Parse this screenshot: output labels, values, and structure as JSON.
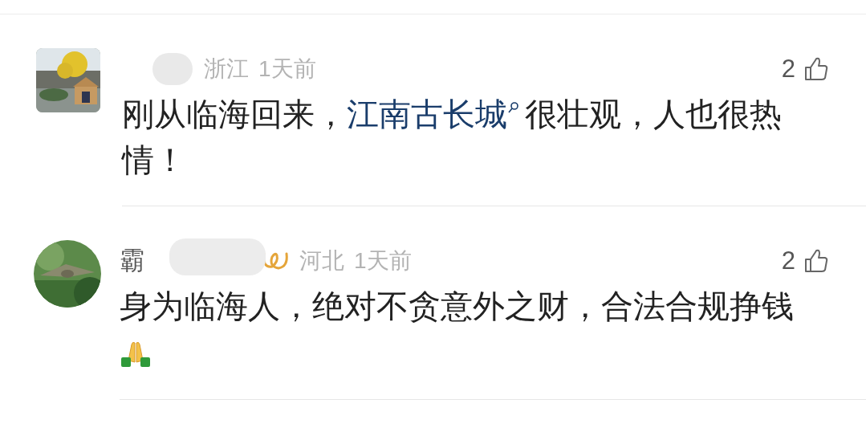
{
  "comments": [
    {
      "avatar": {
        "kind": "square"
      },
      "vip": false,
      "region": "浙江",
      "time": "1天前",
      "likes": "2",
      "body": [
        {
          "kind": "text",
          "text": "刚从临海回来，"
        },
        {
          "kind": "link",
          "text": "江南古长城"
        },
        {
          "kind": "text",
          "text": "很壮观，人也很热情！"
        }
      ]
    },
    {
      "avatar": {
        "kind": "round"
      },
      "name": "霸",
      "vip": true,
      "region": "河北",
      "time": "1天前",
      "likes": "2",
      "body": [
        {
          "kind": "text",
          "text": "身为临海人，绝对不贪意外之财，合法合规挣钱"
        },
        {
          "kind": "emoji"
        }
      ]
    }
  ]
}
